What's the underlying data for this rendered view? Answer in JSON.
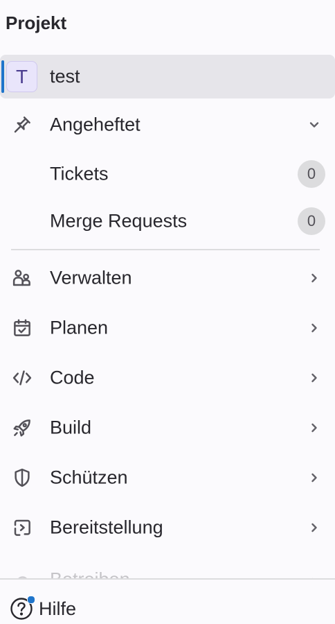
{
  "sidebar": {
    "section_title": "Projekt",
    "project": {
      "avatar_letter": "T",
      "name": "test",
      "accent_color": "#1f75cb"
    },
    "pinned": {
      "label": "Angeheftet",
      "icon": "thumbtack-icon",
      "expanded": true,
      "items": [
        {
          "label": "Tickets",
          "count": "0"
        },
        {
          "label": "Merge Requests",
          "count": "0"
        }
      ]
    },
    "menu": [
      {
        "label": "Verwalten",
        "icon": "users-icon"
      },
      {
        "label": "Planen",
        "icon": "calendar-icon"
      },
      {
        "label": "Code",
        "icon": "code-icon"
      },
      {
        "label": "Build",
        "icon": "rocket-icon"
      },
      {
        "label": "Schützen",
        "icon": "shield-icon"
      },
      {
        "label": "Bereitstellung",
        "icon": "deployments-icon"
      },
      {
        "label": "Betreiben",
        "icon": "cloud-icon"
      }
    ],
    "help": {
      "label": "Hilfe",
      "icon": "question-icon",
      "notification_color": "#1f75cb"
    }
  }
}
